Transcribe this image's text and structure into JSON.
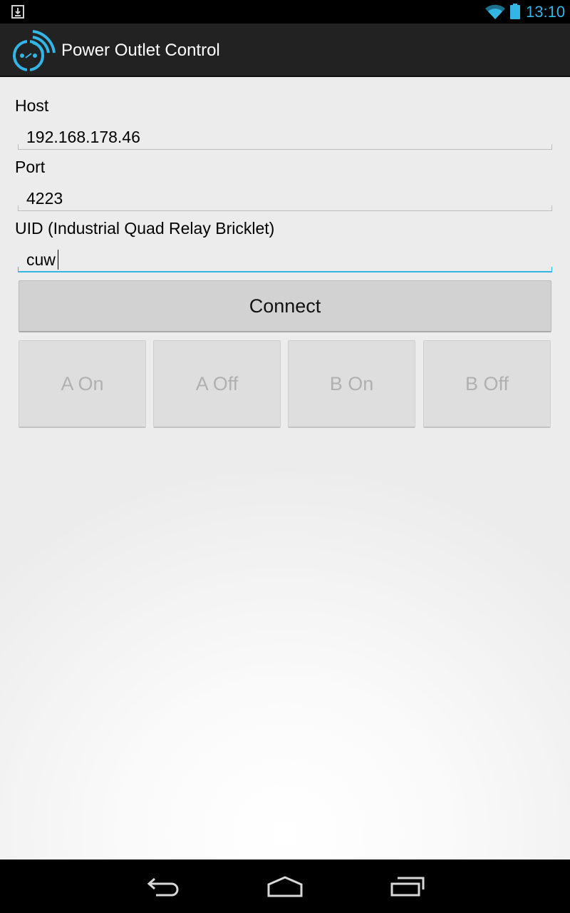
{
  "status_bar": {
    "time": "13:10",
    "icons": [
      "download-notification-icon",
      "wifi-icon",
      "battery-icon"
    ],
    "accent_color": "#33b5e5"
  },
  "action_bar": {
    "title": "Power Outlet Control",
    "icon": "power-outlet-wireless-icon"
  },
  "form": {
    "host_label": "Host",
    "host_value": "192.168.178.46",
    "port_label": "Port",
    "port_value": "4223",
    "uid_label": "UID (Industrial Quad Relay Bricklet)",
    "uid_value": "cuw"
  },
  "buttons": {
    "connect": "Connect",
    "relays": [
      {
        "label": "A On",
        "enabled": false
      },
      {
        "label": "A Off",
        "enabled": false
      },
      {
        "label": "B On",
        "enabled": false
      },
      {
        "label": "B Off",
        "enabled": false
      }
    ]
  },
  "nav_bar": {
    "icons": [
      "back-icon",
      "home-icon",
      "recent-apps-icon"
    ]
  }
}
